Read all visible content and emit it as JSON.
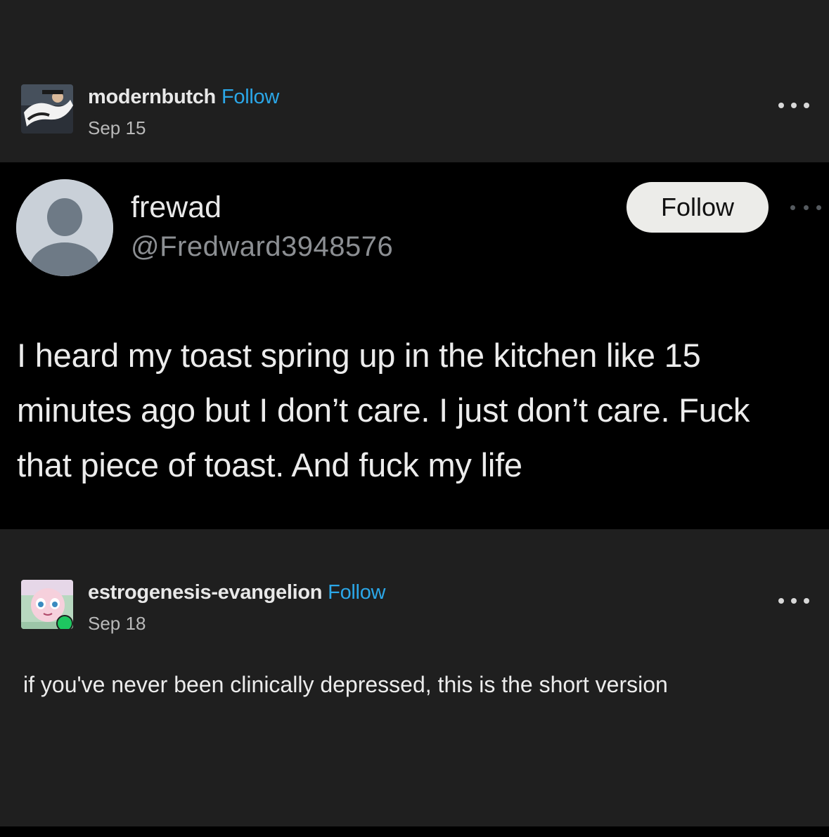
{
  "first_post": {
    "blog_name": "modernbutch",
    "follow_label": "Follow",
    "date": "Sep 15"
  },
  "tweet": {
    "display_name": "frewad",
    "handle": "@Fredward3948576",
    "follow_label": "Follow",
    "text": "I heard my toast spring up in the kitchen like 15 minutes ago but I don’t care. I just don’t care. Fuck that piece of toast. And fuck my life"
  },
  "reblog_post": {
    "blog_name": "estrogenesis-evangelion",
    "follow_label": "Follow",
    "date": "Sep 18",
    "text": "if you've never been clinically depressed, this is the short version"
  },
  "colors": {
    "page_background": "#1f1f1f",
    "tweet_background": "#000000",
    "follow_link": "#2ba7e8",
    "reblog_badge": "#1ec760"
  },
  "icons": {
    "more_options": "ellipsis-icon",
    "reblog": "reblog-icon"
  }
}
